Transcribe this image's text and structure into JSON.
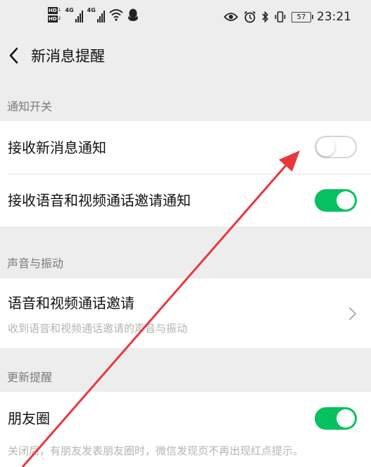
{
  "status_bar": {
    "hd_labels": [
      "HD",
      "HD"
    ],
    "hd_subs": [
      "1",
      "2"
    ],
    "network_types": [
      "4G",
      "4G"
    ],
    "battery": "57",
    "time": "23:21",
    "icons": [
      "eye-icon",
      "alarm-icon",
      "bluetooth-icon",
      "vibrate-icon",
      "battery-icon",
      "wifi-icon",
      "qq-icon"
    ]
  },
  "nav": {
    "title": "新消息提醒",
    "back_icon": "chevron-left-icon"
  },
  "sections": [
    {
      "header": "通知开关",
      "rows": [
        {
          "label": "接收新消息通知",
          "toggle": "off"
        },
        {
          "label": "接收语音和视频通话邀请通知",
          "toggle": "on"
        }
      ]
    },
    {
      "header": "声音与振动",
      "rows": [
        {
          "label": "语音和视频通话邀请",
          "sub": "收到语音和视频通话邀请的声音与振动",
          "chevron": true
        }
      ]
    },
    {
      "header": "更新提醒",
      "rows": [
        {
          "label": "朋友圈",
          "toggle": "on",
          "sub": "关闭后，有朋友发表朋友圈时，微信发现页不再出现红点提示。"
        }
      ]
    }
  ],
  "colors": {
    "accent": "#07c160",
    "arrow": "#e8383d",
    "background": "#ededed"
  }
}
